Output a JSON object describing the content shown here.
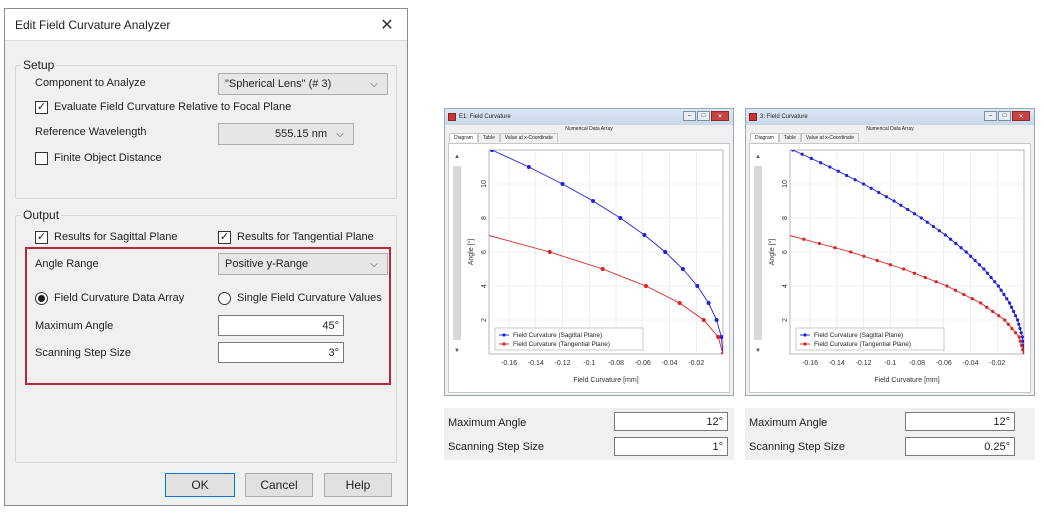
{
  "dialog": {
    "title": "Edit Field Curvature Analyzer",
    "close_glyph": "✕",
    "setup": {
      "title": "Setup",
      "component_label": "Component to Analyze",
      "component_value": "\"Spherical Lens\" (# 3)",
      "evaluate_label": "Evaluate Field Curvature Relative to Focal Plane",
      "evaluate_checked": true,
      "ref_wavelength_label": "Reference Wavelength",
      "ref_wavelength_value": "555.15 nm",
      "finite_label": "Finite Object Distance",
      "finite_checked": false
    },
    "output": {
      "title": "Output",
      "sagittal_label": "Results for Sagittal Plane",
      "sagittal_checked": true,
      "tangential_label": "Results for Tangential Plane",
      "tangential_checked": true,
      "angle_range_label": "Angle Range",
      "angle_range_value": "Positive y-Range",
      "radio_array_label": "Field Curvature Data Array",
      "radio_single_label": "Single Field Curvature Values",
      "selected_radio": "array",
      "max_angle_label": "Maximum Angle",
      "max_angle_value": "45°",
      "step_label": "Scanning Step Size",
      "step_value": "3°"
    },
    "buttons": {
      "ok": "OK",
      "cancel": "Cancel",
      "help": "Help"
    },
    "check_glyph": "✓"
  },
  "windows": [
    {
      "title": "E1: Field Curvature",
      "numerical_label": "Numerical Data Array",
      "tabs": [
        "Diagram",
        "Table",
        "Value at x-Coordinate"
      ],
      "active_tab": 0,
      "xlabel": "Field Curvature [mm]",
      "ylabel": "Angle [°]",
      "legend": [
        "Field Curvature (Sagittal Plane)",
        "Field Curvature (Tangential Plane)"
      ],
      "max_angle_label": "Maximum Angle",
      "max_angle_value": "12°",
      "step_label": "Scanning Step Size",
      "step_value": "1°"
    },
    {
      "title": "3: Field Curvature",
      "numerical_label": "Numerical Data Array",
      "tabs": [
        "Diagram",
        "Table",
        "Value at x-Coordinate"
      ],
      "active_tab": 0,
      "xlabel": "Field Curvature [mm]",
      "ylabel": "Angle [°]",
      "legend": [
        "Field Curvature (Sagittal Plane)",
        "Field Curvature (Tangential Plane)"
      ],
      "max_angle_label": "Maximum Angle",
      "max_angle_value": "12°",
      "step_label": "Scanning Step Size",
      "step_value": "0.25°"
    }
  ],
  "chart_data": [
    {
      "type": "line",
      "xlabel": "Field Curvature [mm]",
      "ylabel": "Angle [°]",
      "xlim": [
        -0.175,
        0.0
      ],
      "ylim": [
        0,
        12
      ],
      "xticks": [
        -0.16,
        -0.14,
        -0.12,
        -0.1,
        -0.08,
        -0.06,
        -0.04,
        -0.02
      ],
      "xtick_labels": [
        "-0.16",
        "-0.14",
        "-0.12",
        "-0.1",
        "-0.08",
        "-0.06",
        "-0.04",
        "-0.02"
      ],
      "yticks": [
        2,
        4,
        6,
        8,
        10
      ],
      "ytick_labels": [
        "2",
        "4",
        "6",
        "8",
        "10"
      ],
      "grid": true,
      "legend_position": "bottom-left",
      "series": [
        {
          "name": "Field Curvature (Sagittal Plane)",
          "color": "#1f1fe0",
          "x": [
            0,
            -0.0012,
            -0.0048,
            -0.0108,
            -0.0192,
            -0.03,
            -0.0432,
            -0.0588,
            -0.0768,
            -0.0972,
            -0.12,
            -0.1452,
            -0.1728
          ],
          "y": [
            0,
            1,
            2,
            3,
            4,
            5,
            6,
            7,
            8,
            9,
            10,
            11,
            12
          ]
        },
        {
          "name": "Field Curvature (Tangential Plane)",
          "color": "#e01f1f",
          "x": [
            0,
            -0.0036,
            -0.0144,
            -0.0324,
            -0.0576,
            -0.09,
            -0.1296,
            -0.1764,
            -0.2304,
            -0.2916,
            -0.36,
            -0.4356,
            -0.5184
          ],
          "y": [
            0,
            1,
            2,
            3,
            4,
            5,
            6,
            7,
            8,
            9,
            10,
            11,
            12
          ]
        }
      ]
    },
    {
      "type": "line",
      "xlabel": "Field Curvature [mm]",
      "ylabel": "Angle [°]",
      "xlim": [
        -0.175,
        0.0
      ],
      "ylim": [
        0,
        12
      ],
      "xticks": [
        -0.16,
        -0.14,
        -0.12,
        -0.1,
        -0.08,
        -0.06,
        -0.04,
        -0.02
      ],
      "xtick_labels": [
        "-0.16",
        "-0.14",
        "-0.12",
        "-0.1",
        "-0.08",
        "-0.06",
        "-0.04",
        "-0.02"
      ],
      "yticks": [
        2,
        4,
        6,
        8,
        10
      ],
      "ytick_labels": [
        "2",
        "4",
        "6",
        "8",
        "10"
      ],
      "grid": true,
      "legend_position": "bottom-left",
      "series": [
        {
          "name": "Field Curvature (Sagittal Plane)",
          "color": "#1f1fe0",
          "x": [],
          "y": []
        },
        {
          "name": "Field Curvature (Tangential Plane)",
          "color": "#e01f1f",
          "x": [],
          "y": []
        }
      ]
    }
  ]
}
